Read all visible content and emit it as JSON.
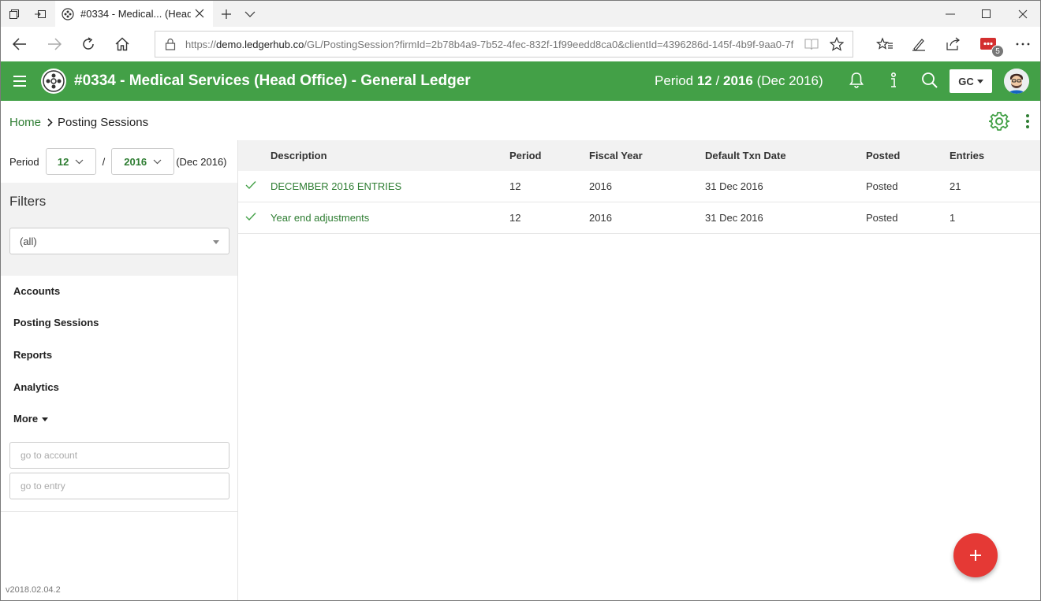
{
  "browser": {
    "tab_title": "#0334 - Medical... (Head",
    "url_prefix": "https://",
    "url_domain": "demo.ledgerhub.co",
    "url_path": "/GL/PostingSession?firmId=2b78b4a9-7b52-4fec-832f-1f99eedd8ca0&clientId=4396286d-145f-4b9f-9aa0-7f",
    "extension_badge": "5"
  },
  "app": {
    "title": "#0334 - Medical Services (Head Office) - General Ledger",
    "period_label": "Period",
    "period_num": "12",
    "period_sep": "/",
    "period_year": "2016",
    "period_desc": "(Dec 2016)",
    "user_initials": "GC",
    "accent": "#43a047"
  },
  "breadcrumb": {
    "home": "Home",
    "current": "Posting Sessions"
  },
  "sidebar": {
    "period_label": "Period",
    "period_value": "12",
    "period_sep": "/",
    "year_value": "2016",
    "period_desc": "(Dec 2016)",
    "filters_title": "Filters",
    "filter_value": "(all)",
    "nav": [
      "Accounts",
      "Posting Sessions",
      "Reports",
      "Analytics",
      "More"
    ],
    "go_account_placeholder": "go to account",
    "go_entry_placeholder": "go to entry",
    "version": "v2018.02.04.2"
  },
  "table": {
    "headers": [
      "Description",
      "Period",
      "Fiscal Year",
      "Default Txn Date",
      "Posted",
      "Entries"
    ],
    "rows": [
      [
        "DECEMBER 2016 ENTRIES",
        "12",
        "2016",
        "31 Dec 2016",
        "Posted",
        "21"
      ],
      [
        "Year end adjustments",
        "12",
        "2016",
        "31 Dec 2016",
        "Posted",
        "1"
      ]
    ]
  }
}
